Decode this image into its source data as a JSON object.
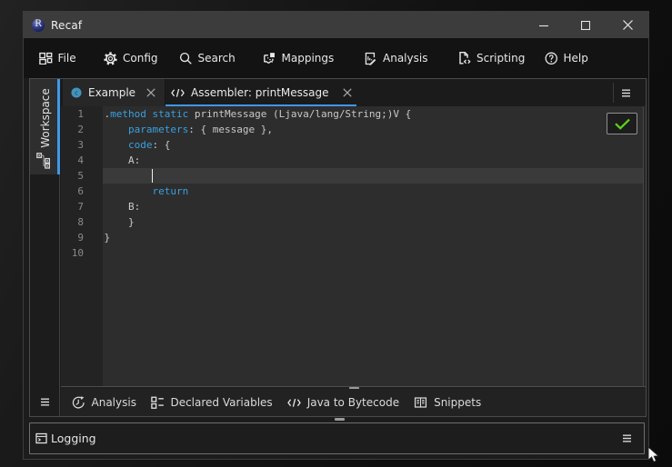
{
  "window": {
    "title": "Recaf",
    "logo_letter": "R",
    "controls": [
      {
        "icon": "minimize-icon"
      },
      {
        "icon": "maximize-icon"
      },
      {
        "icon": "close-icon"
      }
    ]
  },
  "menubar": {
    "items": [
      {
        "label": "File",
        "icon": "workspace-grid-icon"
      },
      {
        "label": "Config",
        "icon": "gear-icon"
      },
      {
        "label": "Search",
        "icon": "search-icon"
      },
      {
        "label": "Mappings",
        "icon": "mappings-icon"
      },
      {
        "label": "Analysis",
        "icon": "report-edit-icon"
      },
      {
        "label": "Scripting",
        "icon": "script-file-icon"
      },
      {
        "label": "Help",
        "icon": "help-circle-icon"
      }
    ]
  },
  "sidebar": {
    "workspace_tab": {
      "label": "Workspace",
      "icon": "tree-hierarchy-icon"
    },
    "menu_icon": "hamburger-icon"
  },
  "tabs": [
    {
      "label": "Example",
      "icon": "class-circle-icon",
      "close_icon": "close-x-icon",
      "active": false
    },
    {
      "label": "Assembler: printMessage",
      "icon": "code-brackets-icon",
      "close_icon": "close-x-icon",
      "active": true
    }
  ],
  "tabbar_menu_icon": "hamburger-icon",
  "editor": {
    "line_count": 10,
    "current_line": 5,
    "caret": {
      "line": 5,
      "column": 8
    },
    "status_icon": "check-icon",
    "code_lines": [
      [
        [
          "pl",
          "."
        ],
        [
          "kw",
          "method"
        ],
        [
          "pl",
          " "
        ],
        [
          "kw",
          "static"
        ],
        [
          "pl",
          " printMessage (Ljava/lang/String;)V {"
        ]
      ],
      [
        [
          "pl",
          "    "
        ],
        [
          "kw",
          "parameters"
        ],
        [
          "pl",
          ": { message },"
        ]
      ],
      [
        [
          "pl",
          "    "
        ],
        [
          "kw",
          "code"
        ],
        [
          "pl",
          ": {"
        ]
      ],
      [
        [
          "pl",
          "    A:"
        ]
      ],
      [],
      [
        [
          "pl",
          "        "
        ],
        [
          "kw",
          "return"
        ]
      ],
      [
        [
          "pl",
          "    B:"
        ]
      ],
      [
        [
          "pl",
          "    }"
        ]
      ],
      [
        [
          "pl",
          "}"
        ]
      ],
      []
    ]
  },
  "editor_toolbar": {
    "items": [
      {
        "label": "Analysis",
        "icon": "analysis-clock-icon"
      },
      {
        "label": "Declared Variables",
        "icon": "list-boxes-icon"
      },
      {
        "label": "Java to Bytecode",
        "icon": "code-brackets-icon"
      },
      {
        "label": "Snippets",
        "icon": "book-icon"
      }
    ]
  },
  "logging": {
    "label": "Logging",
    "icon": "terminal-icon",
    "menu_icon": "hamburger-icon"
  },
  "colors": {
    "accent_blue": "#3e98e8",
    "keyword_blue": "#38a1e0",
    "check_green": "#5ad21c",
    "class_icon_teal": "#4293bc"
  }
}
